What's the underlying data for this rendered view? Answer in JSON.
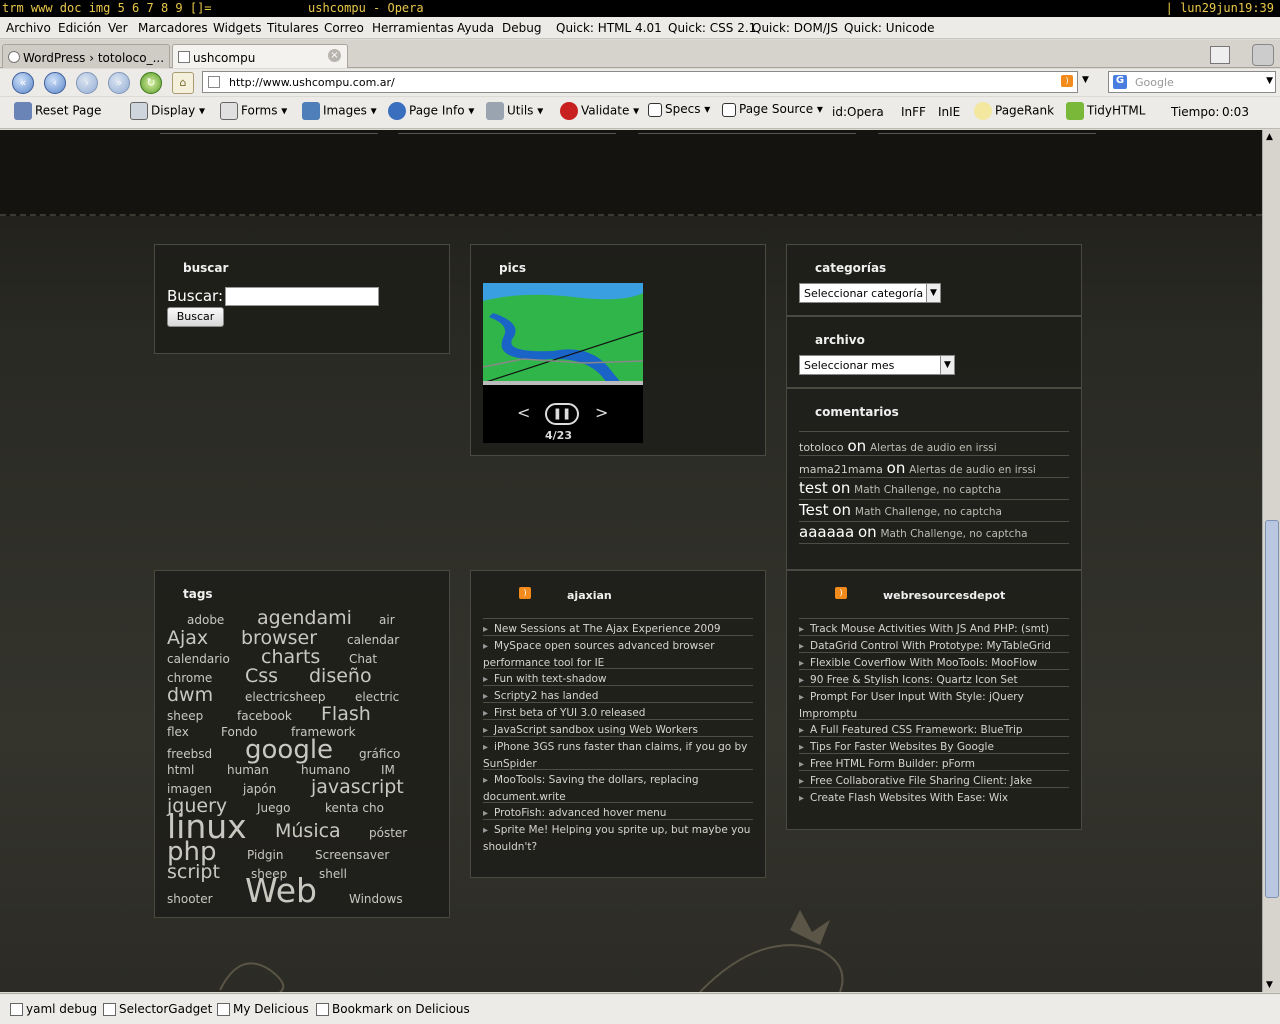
{
  "wm": {
    "left": "trm www doc img 5 6 7 8 9 []=",
    "title": "ushcompu - Opera",
    "clock": "| lun29jun19:39"
  },
  "menu": [
    "Archivo",
    "Edición",
    "Ver",
    "Marcadores",
    "Widgets",
    "Titulares",
    "Correo",
    "Herramientas",
    "Ayuda",
    "Debug",
    "Quick: HTML 4.01",
    "Quick: CSS 2.1",
    "Quick: DOM/JS",
    "Quick: Unicode"
  ],
  "tabs": [
    {
      "label": "WordPress › totoloco_..."
    },
    {
      "label": "ushcompu"
    }
  ],
  "address": {
    "url": "http://www.ushcompu.com.ar/",
    "search_placeholder": "Google"
  },
  "toolbar": {
    "reset": "Reset Page",
    "display": "Display",
    "forms": "Forms",
    "images": "Images",
    "pageinfo": "Page Info",
    "utils": "Utils",
    "validate": "Validate",
    "specs": "Specs",
    "source": "Page Source",
    "id": "id:Opera",
    "inff": "InFF",
    "inie": "InIE",
    "pagerank": "PageRank",
    "tidy": "TidyHTML",
    "tiempo_label": "Tiempo:",
    "tiempo": "0:03"
  },
  "buscar": {
    "title": "buscar",
    "label": "Buscar:",
    "button": "Buscar"
  },
  "pics": {
    "title": "pics",
    "counter": "4/23"
  },
  "categorias": {
    "title": "categorías",
    "select": "Seleccionar categoría"
  },
  "archivo": {
    "title": "archivo",
    "select": "Seleccionar mes"
  },
  "comentarios": {
    "title": "comentarios",
    "items": [
      {
        "user": "totoloco",
        "on": "on",
        "post": "Alertas de audio en irssi"
      },
      {
        "user": "mama21mama",
        "on": "on",
        "post": "Alertas de audio en irssi"
      },
      {
        "user": "test",
        "on": "on",
        "post": "Math Challenge, no captcha"
      },
      {
        "user": "Test",
        "on": "on",
        "post": "Math Challenge, no captcha"
      },
      {
        "user": "aaaaaa",
        "on": "on",
        "post": "Math Challenge, no captcha"
      }
    ]
  },
  "tags": {
    "title": "tags",
    "words": [
      "adobe",
      "agendami",
      "air",
      "Ajax",
      "browser",
      "calendar",
      "calendario",
      "charts",
      "Chat",
      "chrome",
      "Css",
      "diseño",
      "dwm",
      "electricsheep",
      "electric",
      "sheep",
      "facebook",
      "Flash",
      "flex",
      "Fondo",
      "framework",
      "freebsd",
      "google",
      "gráfico",
      "html",
      "human",
      "humano",
      "IM",
      "imagen",
      "japón",
      "javascript",
      "jquery",
      "Juego",
      "kenta cho",
      "linux",
      "Música",
      "póster",
      "php",
      "Pidgin",
      "Screensaver",
      "script",
      "sheep",
      "shell",
      "shooter",
      "Web",
      "Windows"
    ]
  },
  "ajaxian": {
    "title": "ajaxian",
    "items": [
      "New Sessions at The Ajax Experience 2009",
      "MySpace open sources advanced browser performance tool for IE",
      "Fun with text-shadow",
      "Scripty2 has landed",
      "First beta of YUI 3.0 released",
      "JavaScript sandbox using Web Workers",
      "iPhone 3GS runs faster than claims, if you go by SunSpider",
      "MooTools: Saving the dollars, replacing document.write",
      "ProtoFish: advanced hover menu",
      "Sprite Me! Helping you sprite up, but maybe you shouldn't?"
    ]
  },
  "webres": {
    "title": "webresourcesdepot",
    "items": [
      "Track Mouse Activities With JS And PHP: (smt)",
      "DataGrid Control With Prototype: MyTableGrid",
      "Flexible Coverflow With MooTools: MooFlow",
      "90 Free & Stylish Icons: Quartz Icon Set",
      "Prompt For User Input With Style: jQuery Impromptu",
      "A Full Featured CSS Framework: BlueTrip",
      "Tips For Faster Websites By Google",
      "Free HTML Form Builder: pForm",
      "Free Collaborative File Sharing Client: Jake",
      "Create Flash Websites With Ease: Wix"
    ]
  },
  "status": [
    "yaml debug",
    "SelectorGadget",
    "My Delicious",
    "Bookmark on Delicious"
  ]
}
